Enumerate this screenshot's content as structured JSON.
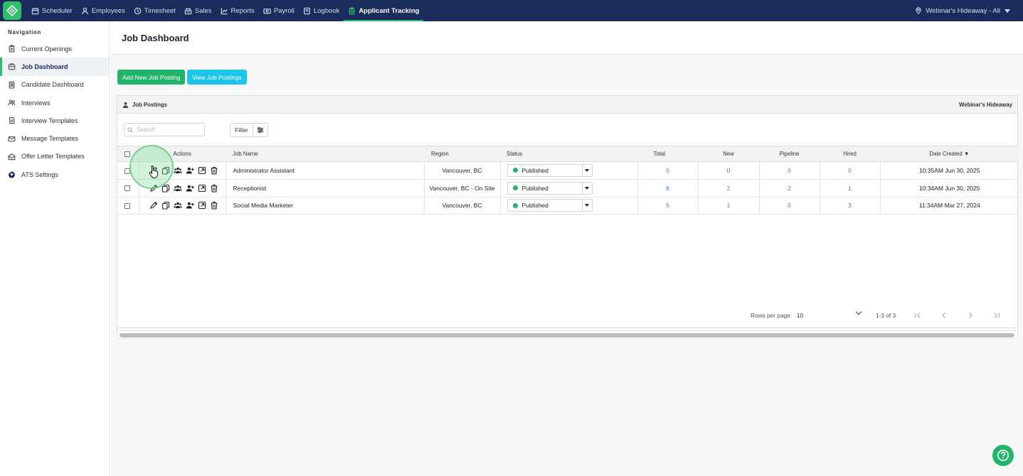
{
  "topnav": {
    "items": [
      {
        "label": "Scheduler",
        "icon": "calendar-icon"
      },
      {
        "label": "Employees",
        "icon": "person-icon"
      },
      {
        "label": "Timesheet",
        "icon": "clock-icon"
      },
      {
        "label": "Sales",
        "icon": "sales-icon"
      },
      {
        "label": "Reports",
        "icon": "chart-icon"
      },
      {
        "label": "Payroll",
        "icon": "payroll-icon"
      },
      {
        "label": "Logbook",
        "icon": "book-icon"
      },
      {
        "label": "Applicant Tracking",
        "icon": "clipboard-icon",
        "active": true
      }
    ],
    "location": "Webinar's Hideaway - All"
  },
  "sidebar": {
    "heading": "Navigation",
    "items": [
      {
        "label": "Current Openings"
      },
      {
        "label": "Job Dashboard",
        "active": true
      },
      {
        "label": "Candidate Dashboard"
      },
      {
        "label": "Interviews"
      },
      {
        "label": "Interview Templates"
      },
      {
        "label": "Message Templates"
      },
      {
        "label": "Offer Letter Templates"
      },
      {
        "label": "ATS Settings"
      }
    ]
  },
  "page": {
    "title": "Job Dashboard",
    "add_button": "Add New Job Posting",
    "view_button": "View Job Postings"
  },
  "card": {
    "title": "Job Postings",
    "location": "Webinar's Hideaway",
    "search_placeholder": "Search",
    "filter_label": "Filter"
  },
  "table": {
    "headers": {
      "actions": "Actions",
      "job_name": "Job Name",
      "region": "Region",
      "status": "Status",
      "total": "Total",
      "new": "New",
      "pipeline": "Pipeline",
      "hired": "Hired",
      "date_created": "Date Created"
    },
    "rows": [
      {
        "job_name": "Administrator Assistant",
        "region": "Vancouver, BC",
        "status": "Published",
        "total": "0",
        "new": "0",
        "pipeline": "0",
        "hired": "0",
        "date": "10:35AM Jun 30, 2025"
      },
      {
        "job_name": "Receptionist",
        "region": "Vancouver, BC - On Site",
        "status": "Published",
        "total": "8",
        "new": "2",
        "pipeline": "2",
        "hired": "1",
        "date": "10:34AM Jun 30, 2025"
      },
      {
        "job_name": "Social Media Marketer",
        "region": "Vancouver, BC",
        "status": "Published",
        "total": "5",
        "new": "1",
        "pipeline": "0",
        "hired": "3",
        "date": "11:34AM Mar 27, 2024"
      }
    ]
  },
  "pagination": {
    "rows_label": "Rows per page:",
    "rows_value": "10",
    "range": "1-3 of 3"
  },
  "colors": {
    "topbar": "#1a2b5c",
    "accent_green": "#22b46a",
    "accent_cyan": "#1cc4e8",
    "link_blue": "#3b82c4"
  }
}
